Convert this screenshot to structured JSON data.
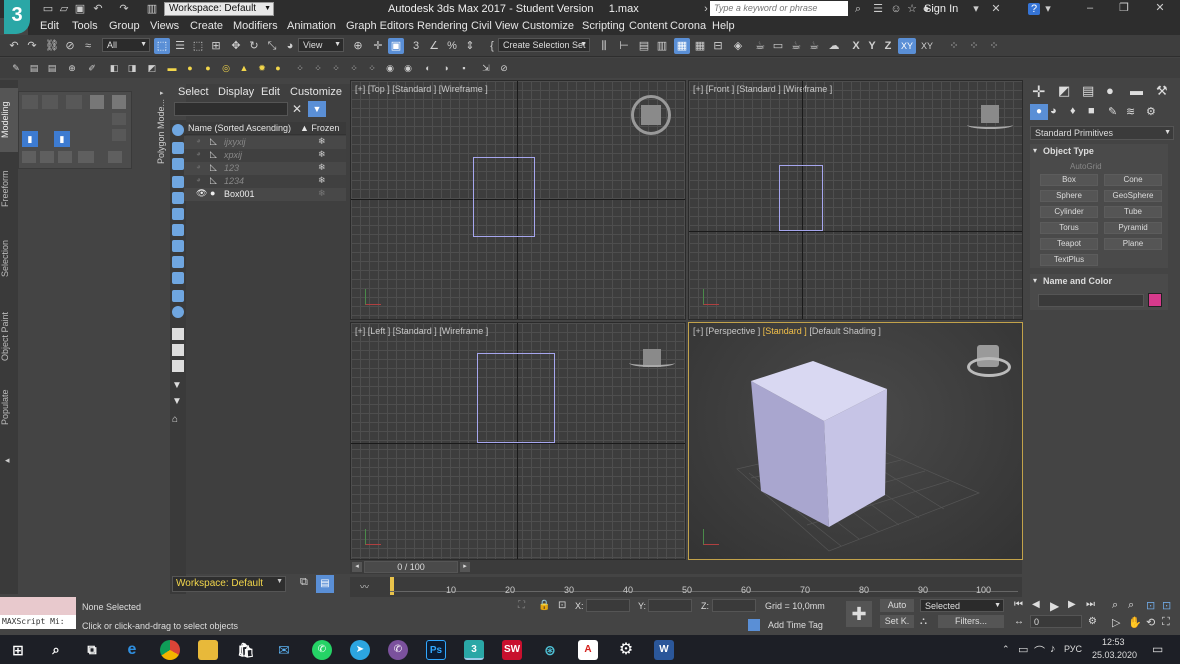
{
  "title": {
    "workspace_label": "Workspace: Default",
    "window_title": "Autodesk 3ds Max 2017 - Student Version     1.max",
    "search_placeholder": "Type a keyword or phrase",
    "sign_in": "Sign In",
    "logo_text": "3"
  },
  "menu": [
    "Edit",
    "Tools",
    "Group",
    "Views",
    "Create",
    "Modifiers",
    "Animation",
    "Graph Editors",
    "Rendering",
    "Civil View",
    "Customize",
    "Scripting",
    "Content",
    "Corona",
    "Help"
  ],
  "toolbar1": {
    "filter_all": "All",
    "view_ref": "View",
    "selection_set": "Create Selection Set",
    "axis_x": "X",
    "axis_y": "Y",
    "axis_z": "Z",
    "axis_xy": "XY",
    "axis_xy2": "XY"
  },
  "ribbon": {
    "tabs": [
      "Modeling",
      "Freeform",
      "Selection",
      "Object Paint",
      "Populate"
    ],
    "poly_mode": "Polygon Mode..."
  },
  "explorer": {
    "menus": [
      "Select",
      "Display",
      "Edit",
      "Customize"
    ],
    "col_name": "Name (Sorted Ascending)",
    "col_frozen": "▲ Frozen",
    "rows": [
      {
        "name": "ijxyxij"
      },
      {
        "name": "xpxij"
      },
      {
        "name": "123"
      },
      {
        "name": "1234"
      },
      {
        "name": "Box001"
      }
    ],
    "workspace": "Workspace: Default"
  },
  "viewports": {
    "top": "[+] [Top ] [Standard ] [Wireframe ]",
    "front": "[+] [Front ] [Standard ] [Wireframe ]",
    "left": "[+] [Left ] [Standard ] [Wireframe ]",
    "persp_a": "[+] [Perspective ] ",
    "persp_b": "[Standard ]",
    "persp_c": " [Default Shading ]"
  },
  "command_panel": {
    "category": "Standard Primitives",
    "object_type": "Object Type",
    "autogrid": "AutoGrid",
    "primitives": [
      "Box",
      "Cone",
      "Sphere",
      "GeoSphere",
      "Cylinder",
      "Tube",
      "Torus",
      "Pyramid",
      "Teapot",
      "Plane",
      "TextPlus"
    ],
    "name_color": "Name and Color",
    "swatch_color": "#d63a8c"
  },
  "timeline": {
    "frame": "0 / 100",
    "ticks": [
      "10",
      "20",
      "30",
      "40",
      "50",
      "60",
      "70",
      "80",
      "90",
      "100"
    ]
  },
  "status": {
    "maxscript": "MAXScript Mi:",
    "selection": "None Selected",
    "prompt": "Click or click-and-drag to select objects",
    "x_label": "X:",
    "y_label": "Y:",
    "z_label": "Z:",
    "grid": "Grid = 10,0mm",
    "add_time_tag": "Add Time Tag",
    "auto": "Auto",
    "selected": "Selected",
    "set_key": "Set K.",
    "filters": "Filters...",
    "frame_value": "0"
  },
  "taskbar": {
    "lang": "РУС",
    "time": "12:53",
    "date": "25.03.2020"
  }
}
